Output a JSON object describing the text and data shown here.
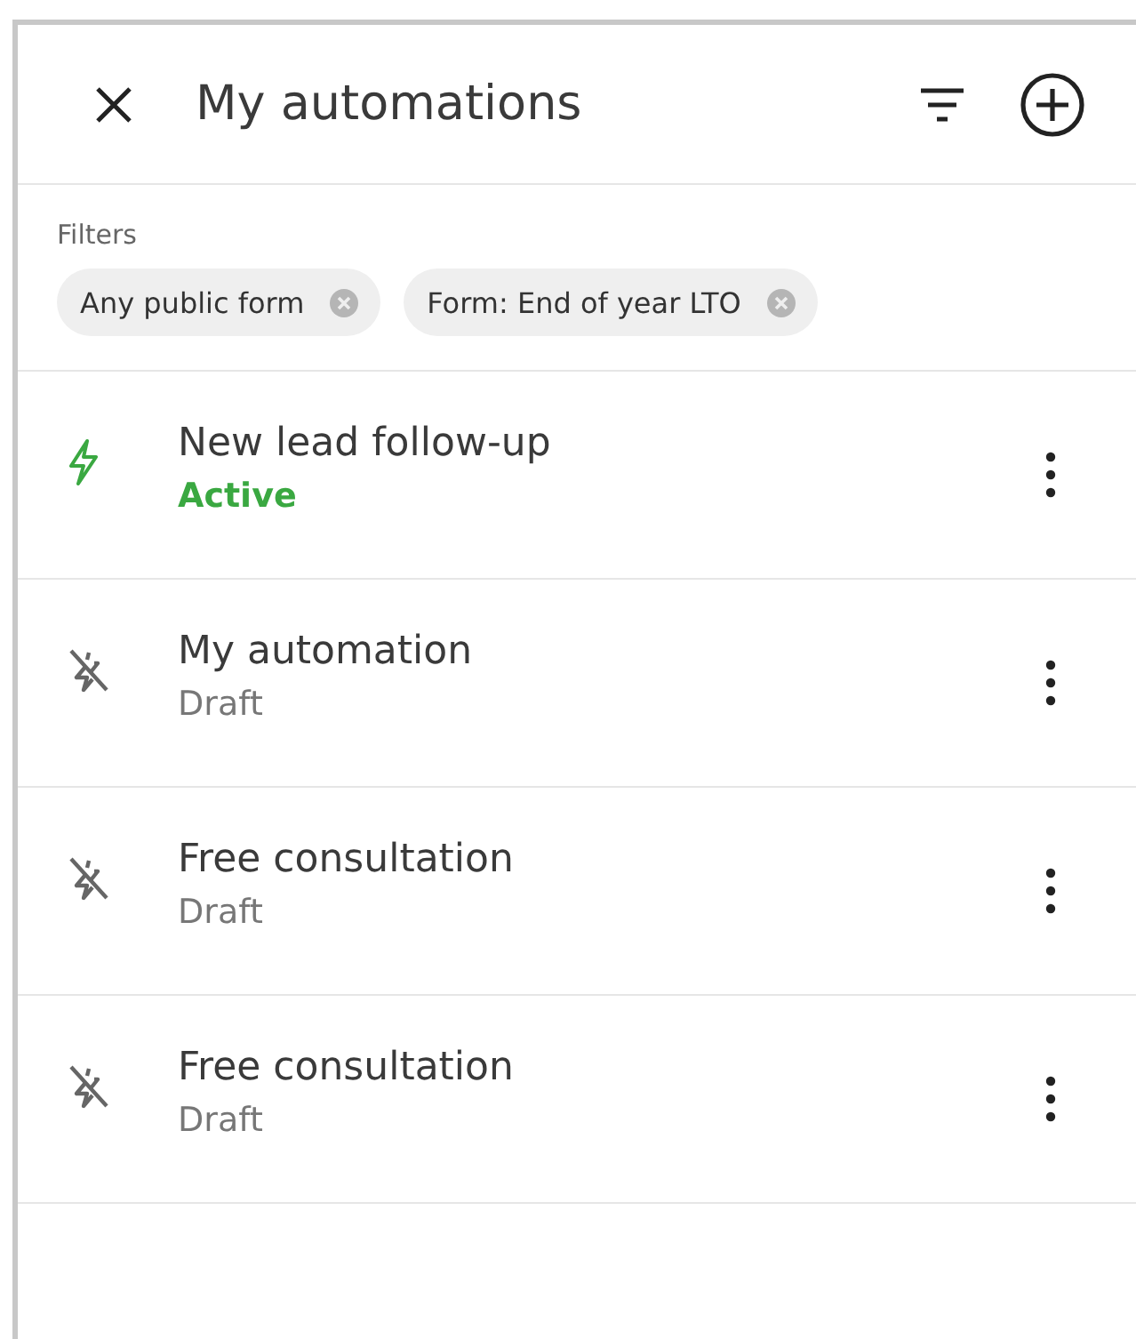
{
  "header": {
    "title": "My automations"
  },
  "filters": {
    "label": "Filters",
    "chips": [
      {
        "label": "Any public form"
      },
      {
        "label": "Form: End of year LTO"
      }
    ]
  },
  "automations": [
    {
      "name": "New lead follow-up",
      "status": "Active",
      "kind": "active"
    },
    {
      "name": "My automation",
      "status": "Draft",
      "kind": "draft"
    },
    {
      "name": "Free consultation",
      "status": "Draft",
      "kind": "draft"
    },
    {
      "name": "Free consultation",
      "status": "Draft",
      "kind": "draft"
    }
  ]
}
